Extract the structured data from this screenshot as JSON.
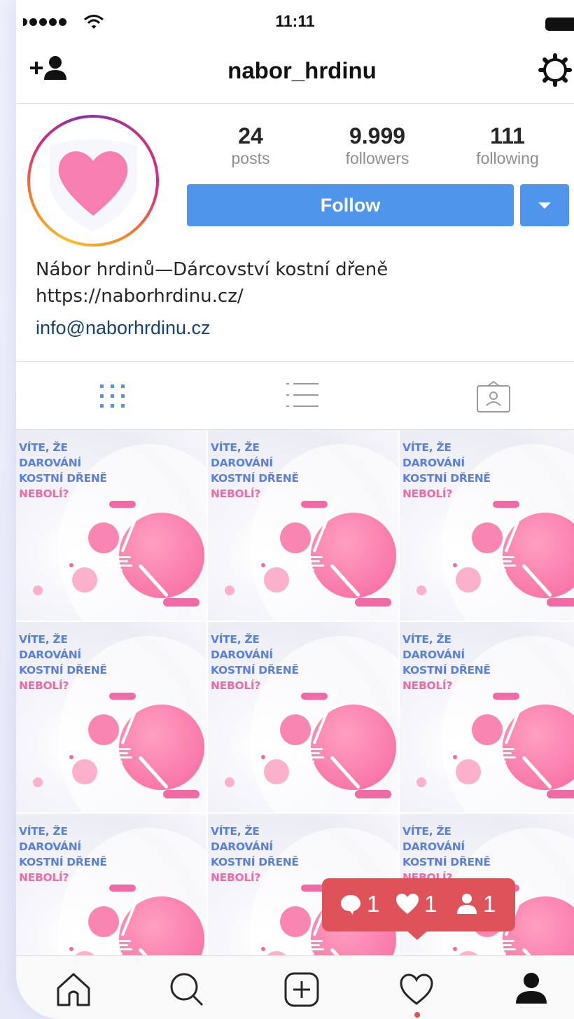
{
  "status_bar": {
    "time": "11:11"
  },
  "header": {
    "username": "nabor_hrdinu"
  },
  "profile": {
    "stats": [
      {
        "value": "24",
        "label": "posts"
      },
      {
        "value": "9.999",
        "label": "followers"
      },
      {
        "value": "111",
        "label": "following"
      }
    ],
    "follow_label": "Follow",
    "bio": {
      "name": "Nábor hrdinů—Dárcovství kostní dřeně",
      "website": "https://naborhrdinu.cz/",
      "email": "info@naborhrdinu.cz"
    }
  },
  "tabs": [
    {
      "icon": "grid-icon",
      "active": true
    },
    {
      "icon": "list-icon",
      "active": false
    },
    {
      "icon": "tagged-icon",
      "active": false
    }
  ],
  "post_text": {
    "line1": "VÍTE, ŽE",
    "line2": "DAROVÁNÍ",
    "line3": "KOSTNÍ DŘENĚ",
    "line4": "NEBOLÍ?"
  },
  "notification": {
    "comments": "1",
    "likes": "1",
    "follows": "1",
    "color": "#e0525a"
  },
  "colors": {
    "accent": "#4f95ec",
    "title_blue": "#5b7fe0",
    "title_pink": "#f06aa5"
  },
  "bottom_nav": [
    "home-icon",
    "search-icon",
    "add-post-icon",
    "activity-icon",
    "profile-icon"
  ]
}
